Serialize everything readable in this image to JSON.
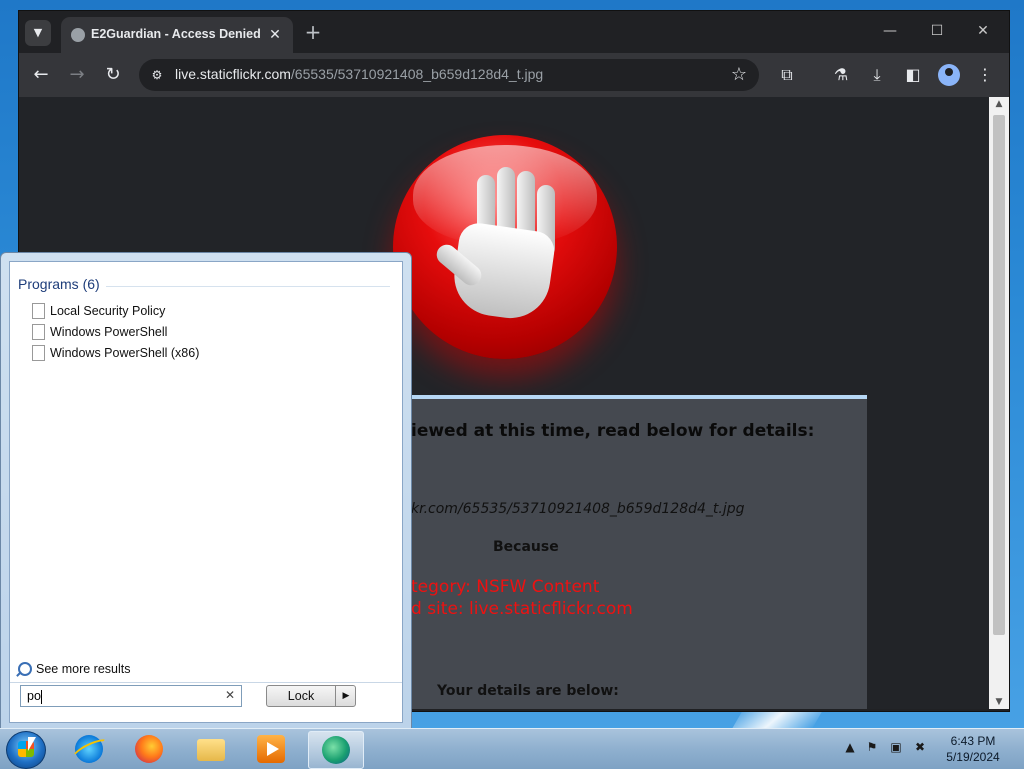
{
  "browser": {
    "tab_title": "E2Guardian - Access Denied",
    "url_host": "live.staticflickr.com",
    "url_path": "/65535/53710921408_b659d128d4_t.jpg"
  },
  "blockpage": {
    "heading": "iewed at this time, read below for details:",
    "url_fragment": "kr.com/65535/53710921408_b659d128d4_t.jpg",
    "because": "Because",
    "reason_1": "tegory: NSFW Content",
    "reason_2": "d site: live.staticflickr.com",
    "details_heading": "Your details are below:"
  },
  "startmenu": {
    "section_title": "Programs (6)",
    "items": [
      {
        "label": "Local Security Policy"
      },
      {
        "label": "Windows PowerShell"
      },
      {
        "label": "Windows PowerShell (x86)"
      }
    ],
    "see_more": "See more results",
    "search_value": "po",
    "lock_label": "Lock"
  },
  "taskbar": {
    "clock_time": "6:43 PM",
    "clock_date": "5/19/2024"
  },
  "colors": {
    "block_reason": "#ee1111",
    "stop_red": "#e60d0d"
  }
}
